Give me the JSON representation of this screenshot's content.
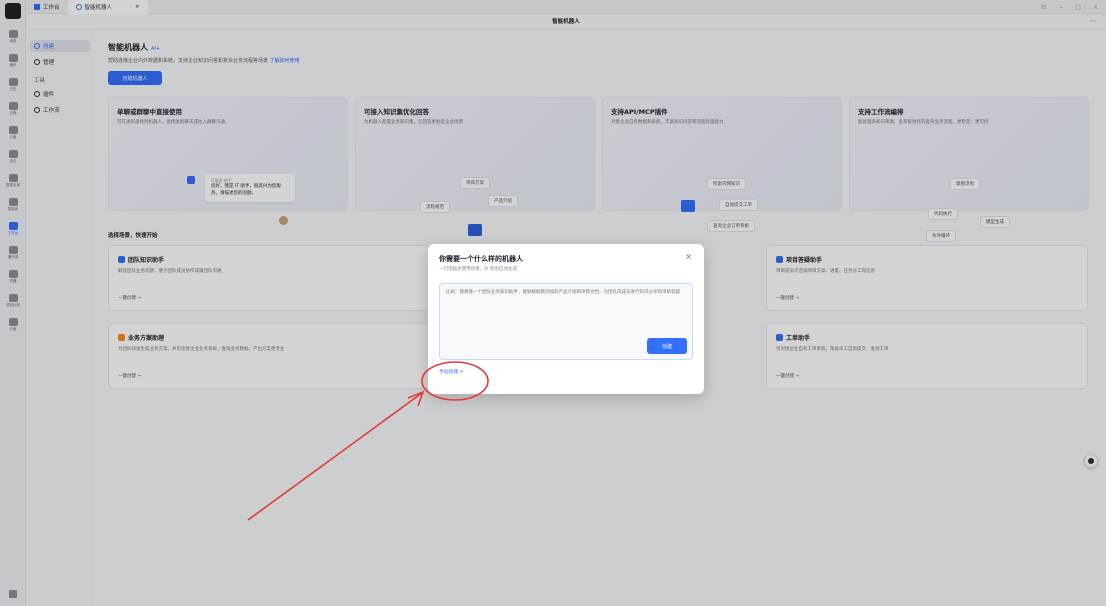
{
  "titlebar": {
    "tabs": [
      {
        "label": "工作台"
      },
      {
        "label": "智能机器人"
      }
    ],
    "close_glyph": "×",
    "win_controls": [
      "⊡",
      "−",
      "□",
      "×"
    ]
  },
  "header": {
    "title": "智能机器人",
    "more": "···"
  },
  "rail": {
    "items": [
      {
        "label": "消息"
      },
      {
        "label": "通讯"
      },
      {
        "label": "日历"
      },
      {
        "label": "日程"
      },
      {
        "label": "云盘"
      },
      {
        "label": "会议"
      },
      {
        "label": "智能应用"
      },
      {
        "label": "智能体"
      },
      {
        "label": "工作台"
      },
      {
        "label": "通讯录"
      },
      {
        "label": "机器"
      },
      {
        "label": "项目比较"
      },
      {
        "label": "分组"
      }
    ]
  },
  "leftnav": {
    "create": "创建",
    "manage": "管理",
    "group_tools": "工具",
    "plugin": "插件",
    "workflow": "工作流"
  },
  "main": {
    "title": "智能机器人",
    "title_tag": "AI+",
    "desc": "帮助连接企业内外数据和系统，支持企业知识问答和复杂业务流程等场景",
    "desc_link": "了解如何使用",
    "create_button": "创建机器人",
    "features": [
      {
        "title": "单聊或群聊中直接使用",
        "desc": "可在通讯录找到机器人，直接发起聊天或拉入群聊沟通。"
      },
      {
        "title": "可接入知识集优化回答",
        "desc": "为机器人配置业务知识集，让回答更贴近企业场景"
      },
      {
        "title": "支持API/MCP插件",
        "desc": "对接企业自有数据和系统，丰富知识问答和流程处理能力"
      },
      {
        "title": "支持工作流编排",
        "desc": "能处理多知识来源、多系统协作的复杂业务流程，更稳定、更可控"
      }
    ],
    "feature1_visual": {
      "bot_name": "IT服务 助手",
      "bubble": "您好，我是 IT 助手，很高兴为您服务。请描述您的问题。"
    },
    "feature2_visual": {
      "chips": [
        "项目方案",
        "产品介绍",
        "流程规范"
      ]
    },
    "feature3_visual": {
      "chips": [
        "检索内网知识",
        "自动提交工单",
        "查询企业订单系统"
      ]
    },
    "feature4_visual": {
      "chips": [
        "意图识别",
        "代码执行",
        "模型生成",
        "条件循环"
      ]
    },
    "section_title": "选择场景，快速开始",
    "cards": [
      {
        "title": "团队知识助手",
        "desc": "解答团队业务问题，便于团队成员协作或跟团队沟通",
        "action": "一键创建 →"
      },
      {
        "title": "项目答疑助手",
        "desc": "项目成员可咨询项目方案、进度、任务分工等信息",
        "action": "一键创建 →"
      },
      {
        "title": "业务方案助理",
        "desc": "为团队快速生成业务方案，并可连接企业业务系统，查询业务数据，产出方案更专业",
        "action": "一键创建 →"
      },
      {
        "title": "工单助手",
        "desc": "可对接企业自有工单系统，帮助员工自助提交、查询工单",
        "action": "一键创建 →"
      }
    ]
  },
  "modal": {
    "title": "你需要一个什么样的机器人",
    "subtitle": "一句话描述使用场景，AI 帮你自动生成",
    "close": "×",
    "placeholder": "比如：我想要一个团队业务知识助手，能够根据我添加的产品介绍和项目文档，为团队内成员进行知识分享和项目答疑",
    "submit": "创建",
    "manual_link": "手动创建 >"
  },
  "colors": {
    "accent": "#3370ff",
    "annotation": "#e53935"
  }
}
